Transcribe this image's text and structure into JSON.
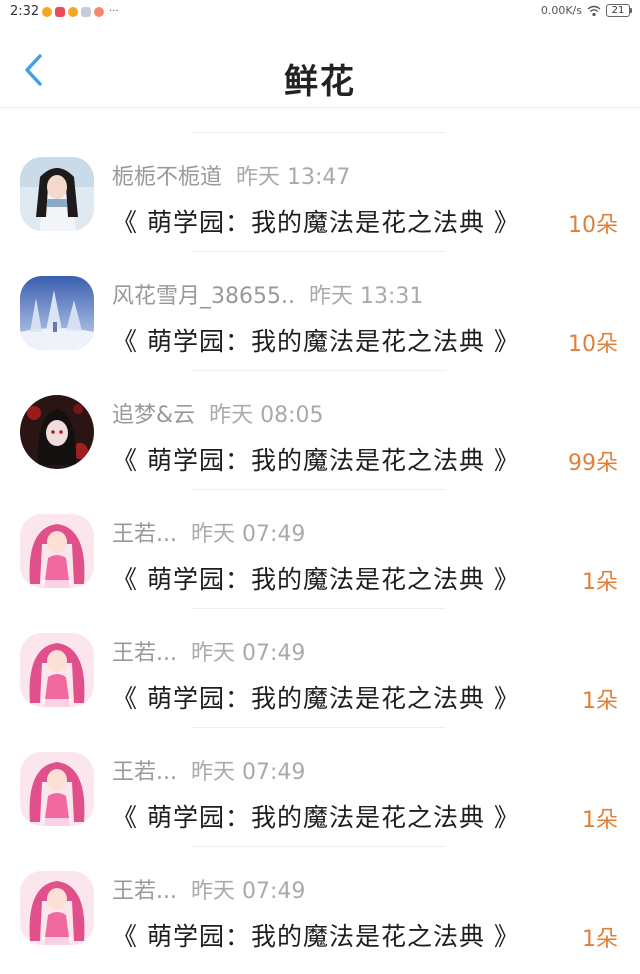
{
  "status_bar": {
    "time": "2:32",
    "more": "···",
    "network_speed": "0.00K/s",
    "battery": "21"
  },
  "nav": {
    "title": "鲜花"
  },
  "colors": {
    "accent_blue": "#3f9fe8",
    "amount_orange": "#e07f3a"
  },
  "records": [
    {
      "user": "栀栀不栀道",
      "time": "昨天 13:47",
      "book": "《 萌学园：我的魔法是花之法典 》",
      "amount": "10朵",
      "avatar": "girl-winter-photo-icon"
    },
    {
      "user": "风花雪月_38655..",
      "time": "昨天 13:31",
      "book": "《 萌学园：我的魔法是花之法典 》",
      "amount": "10朵",
      "avatar": "snowy-trees-icon"
    },
    {
      "user": "追梦&云",
      "time": "昨天 08:05",
      "book": "《 萌学园：我的魔法是花之法典 》",
      "amount": "99朵",
      "avatar": "dark-anime-girl-icon"
    },
    {
      "user": "王若...",
      "time": "昨天 07:49",
      "book": "《 萌学园：我的魔法是花之法典 》",
      "amount": "1朵",
      "avatar": "pink-anime-girl-icon"
    },
    {
      "user": "王若...",
      "time": "昨天 07:49",
      "book": "《 萌学园：我的魔法是花之法典 》",
      "amount": "1朵",
      "avatar": "pink-anime-girl-icon"
    },
    {
      "user": "王若...",
      "time": "昨天 07:49",
      "book": "《 萌学园：我的魔法是花之法典 》",
      "amount": "1朵",
      "avatar": "pink-anime-girl-icon"
    },
    {
      "user": "王若...",
      "time": "昨天 07:49",
      "book": "《 萌学园：我的魔法是花之法典 》",
      "amount": "1朵",
      "avatar": "pink-anime-girl-icon"
    }
  ]
}
